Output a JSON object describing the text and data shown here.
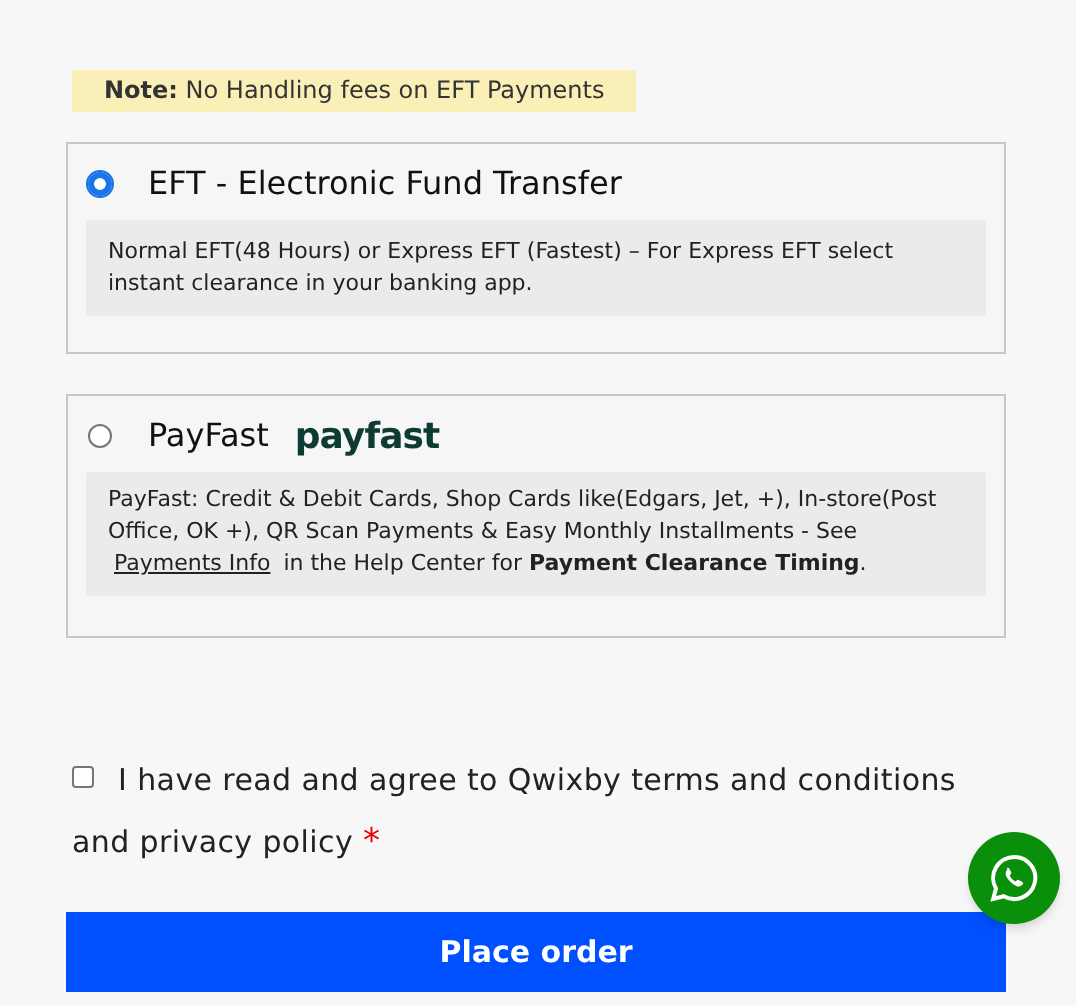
{
  "note": {
    "label": "Note:",
    "text": "No Handling fees on EFT Payments"
  },
  "payment_methods": [
    {
      "title": "EFT - Electronic Fund Transfer",
      "selected": true,
      "description": "Normal EFT(48 Hours) or Express EFT (Fastest) – For Express EFT select instant clearance in your banking app."
    },
    {
      "title": "PayFast",
      "selected": false,
      "logo": "payfast",
      "description": "PayFast: Credit & Debit Cards, Shop Cards like(Edgars, Jet, +), In-store(Post Office, OK +), QR Scan Payments & Easy Monthly Installments - See",
      "link": "Payments Info",
      "description_after": "in the Help Center for **Payment Clearance Timing**."
    }
  ],
  "terms": {
    "checked": false,
    "text": "I have read and agree to Qwixby terms and conditions and privacy policy",
    "required_mark": "*"
  },
  "place_order": "Place order"
}
